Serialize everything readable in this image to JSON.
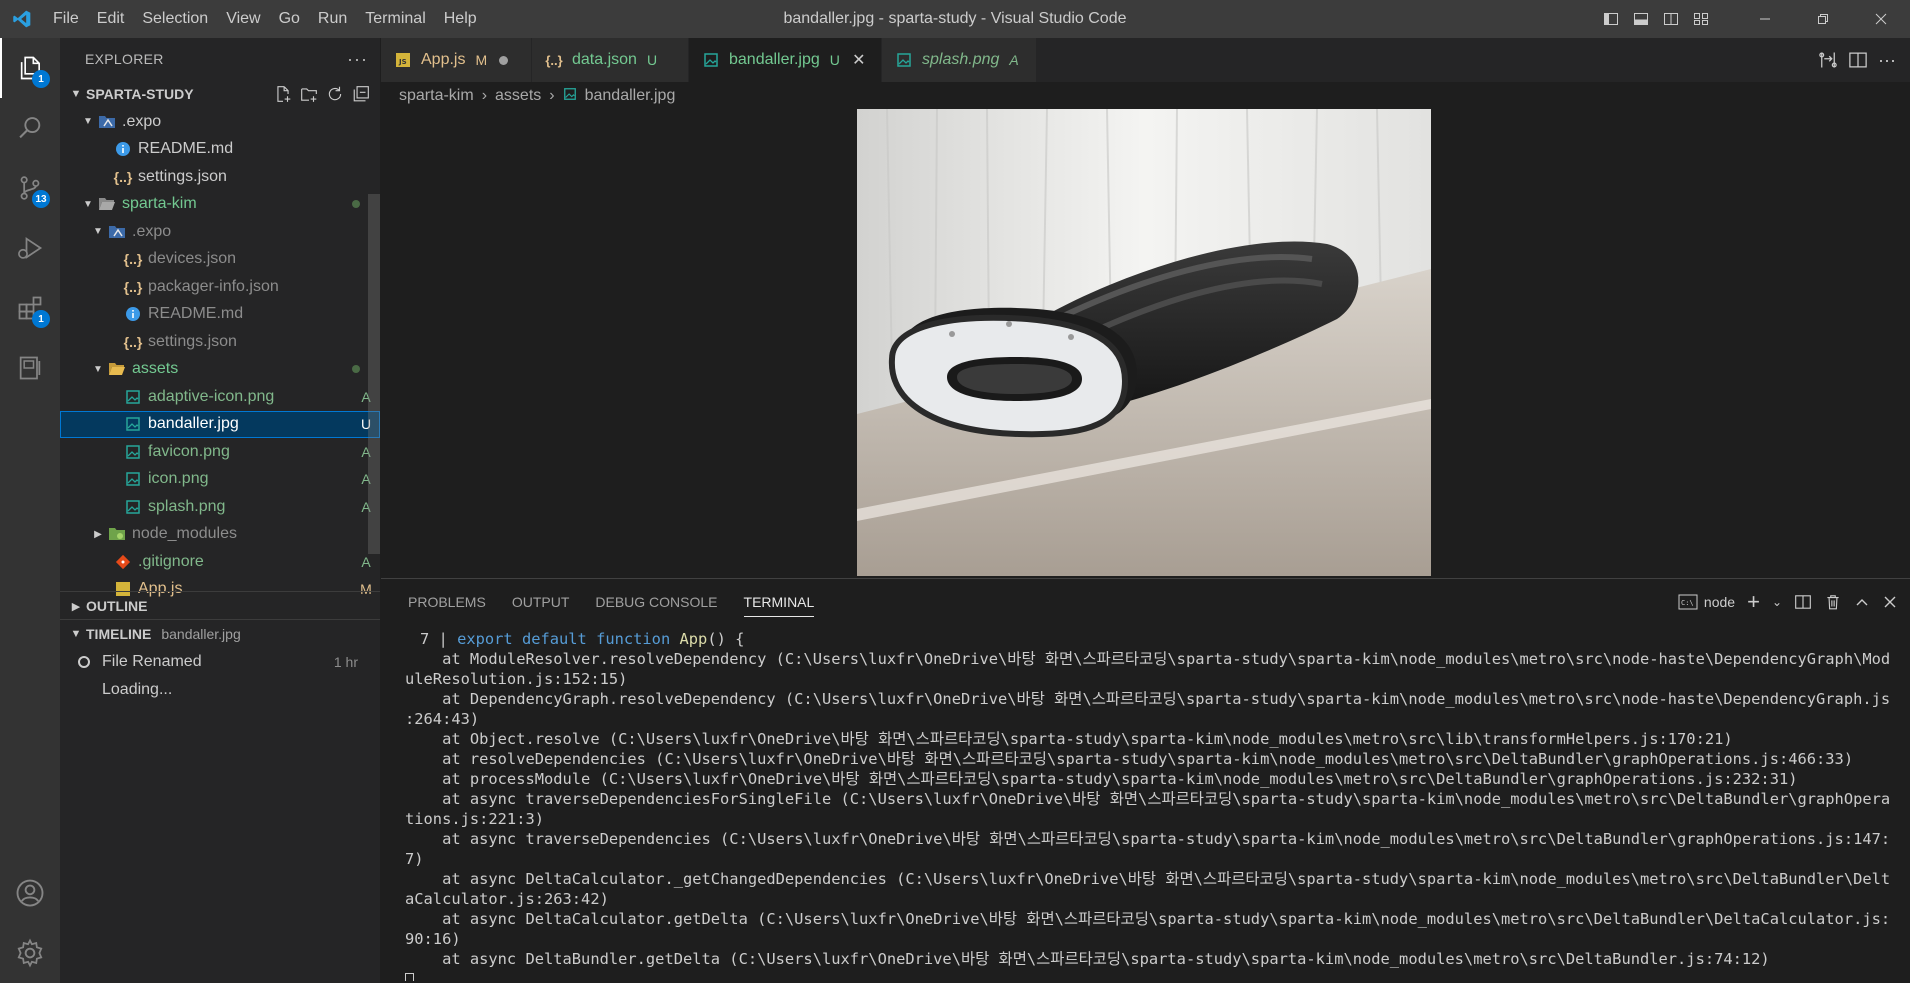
{
  "window": {
    "title": "bandaller.jpg - sparta-study - Visual Studio Code"
  },
  "menu": [
    "File",
    "Edit",
    "Selection",
    "View",
    "Go",
    "Run",
    "Terminal",
    "Help"
  ],
  "activity": {
    "explorer_badge": "1",
    "source_control_badge": "13",
    "extensions_badge": "1"
  },
  "sidebar": {
    "title": "EXPLORER",
    "workspace": "SPARTA-STUDY",
    "tree": [
      {
        "label": ".expo",
        "status": ""
      },
      {
        "label": "README.md",
        "status": ""
      },
      {
        "label": "settings.json",
        "status": ""
      },
      {
        "label": "sparta-kim",
        "status": ""
      },
      {
        "label": ".expo",
        "status": ""
      },
      {
        "label": "devices.json",
        "status": ""
      },
      {
        "label": "packager-info.json",
        "status": ""
      },
      {
        "label": "README.md",
        "status": ""
      },
      {
        "label": "settings.json",
        "status": ""
      },
      {
        "label": "assets",
        "status": ""
      },
      {
        "label": "adaptive-icon.png",
        "status": "A"
      },
      {
        "label": "bandaller.jpg",
        "status": "U"
      },
      {
        "label": "favicon.png",
        "status": "A"
      },
      {
        "label": "icon.png",
        "status": "A"
      },
      {
        "label": "splash.png",
        "status": "A"
      },
      {
        "label": "node_modules",
        "status": ""
      },
      {
        "label": ".gitignore",
        "status": "A"
      },
      {
        "label": "App.js",
        "status": "M"
      }
    ],
    "outline_label": "OUTLINE",
    "timeline": {
      "label": "TIMELINE",
      "file": "bandaller.jpg",
      "entry_label": "File Renamed",
      "entry_time": "1 hr",
      "loading": "Loading..."
    }
  },
  "tabs": [
    {
      "label": "App.js",
      "status": "M"
    },
    {
      "label": "data.json",
      "status": "U"
    },
    {
      "label": "bandaller.jpg",
      "status": "U"
    },
    {
      "label": "splash.png",
      "status": "A"
    }
  ],
  "breadcrumb": [
    "sparta-kim",
    "assets",
    "bandaller.jpg"
  ],
  "panel": {
    "tabs": [
      "PROBLEMS",
      "OUTPUT",
      "DEBUG CONSOLE",
      "TERMINAL"
    ],
    "terminal_name": "node",
    "first_line_number": "7",
    "first_line_kw": "export default function",
    "first_line_fn": "App",
    "first_line_rest": "() {",
    "lines": [
      "    at ModuleResolver.resolveDependency (C:\\Users\\luxfr\\OneDrive\\바탕 화면\\스파르타코딩\\sparta-study\\sparta-kim\\node_modules\\metro\\src\\node-haste\\DependencyGraph\\Mod",
      "uleResolution.js:152:15)",
      "    at DependencyGraph.resolveDependency (C:\\Users\\luxfr\\OneDrive\\바탕 화면\\스파르타코딩\\sparta-study\\sparta-kim\\node_modules\\metro\\src\\node-haste\\DependencyGraph.js",
      ":264:43)",
      "    at Object.resolve (C:\\Users\\luxfr\\OneDrive\\바탕 화면\\스파르타코딩\\sparta-study\\sparta-kim\\node_modules\\metro\\src\\lib\\transformHelpers.js:170:21)",
      "    at resolveDependencies (C:\\Users\\luxfr\\OneDrive\\바탕 화면\\스파르타코딩\\sparta-study\\sparta-kim\\node_modules\\metro\\src\\DeltaBundler\\graphOperations.js:466:33)",
      "    at processModule (C:\\Users\\luxfr\\OneDrive\\바탕 화면\\스파르타코딩\\sparta-study\\sparta-kim\\node_modules\\metro\\src\\DeltaBundler\\graphOperations.js:232:31)",
      "    at async traverseDependenciesForSingleFile (C:\\Users\\luxfr\\OneDrive\\바탕 화면\\스파르타코딩\\sparta-study\\sparta-kim\\node_modules\\metro\\src\\DeltaBundler\\graphOpera",
      "tions.js:221:3)",
      "    at async traverseDependencies (C:\\Users\\luxfr\\OneDrive\\바탕 화면\\스파르타코딩\\sparta-study\\sparta-kim\\node_modules\\metro\\src\\DeltaBundler\\graphOperations.js:147:",
      "7)",
      "    at async DeltaCalculator._getChangedDependencies (C:\\Users\\luxfr\\OneDrive\\바탕 화면\\스파르타코딩\\sparta-study\\sparta-kim\\node_modules\\metro\\src\\DeltaBundler\\Delt",
      "aCalculator.js:263:42)",
      "    at async DeltaCalculator.getDelta (C:\\Users\\luxfr\\OneDrive\\바탕 화면\\스파르타코딩\\sparta-study\\sparta-kim\\node_modules\\metro\\src\\DeltaBundler\\DeltaCalculator.js:",
      "90:16)",
      "    at async DeltaBundler.getDelta (C:\\Users\\luxfr\\OneDrive\\바탕 화면\\스파르타코딩\\sparta-study\\sparta-kim\\node_modules\\metro\\src\\DeltaBundler.js:74:12)"
    ]
  },
  "colors": {
    "accent": "#0078d4",
    "modified": "#e2c08d",
    "added": "#81b88b",
    "untracked": "#73c991"
  }
}
